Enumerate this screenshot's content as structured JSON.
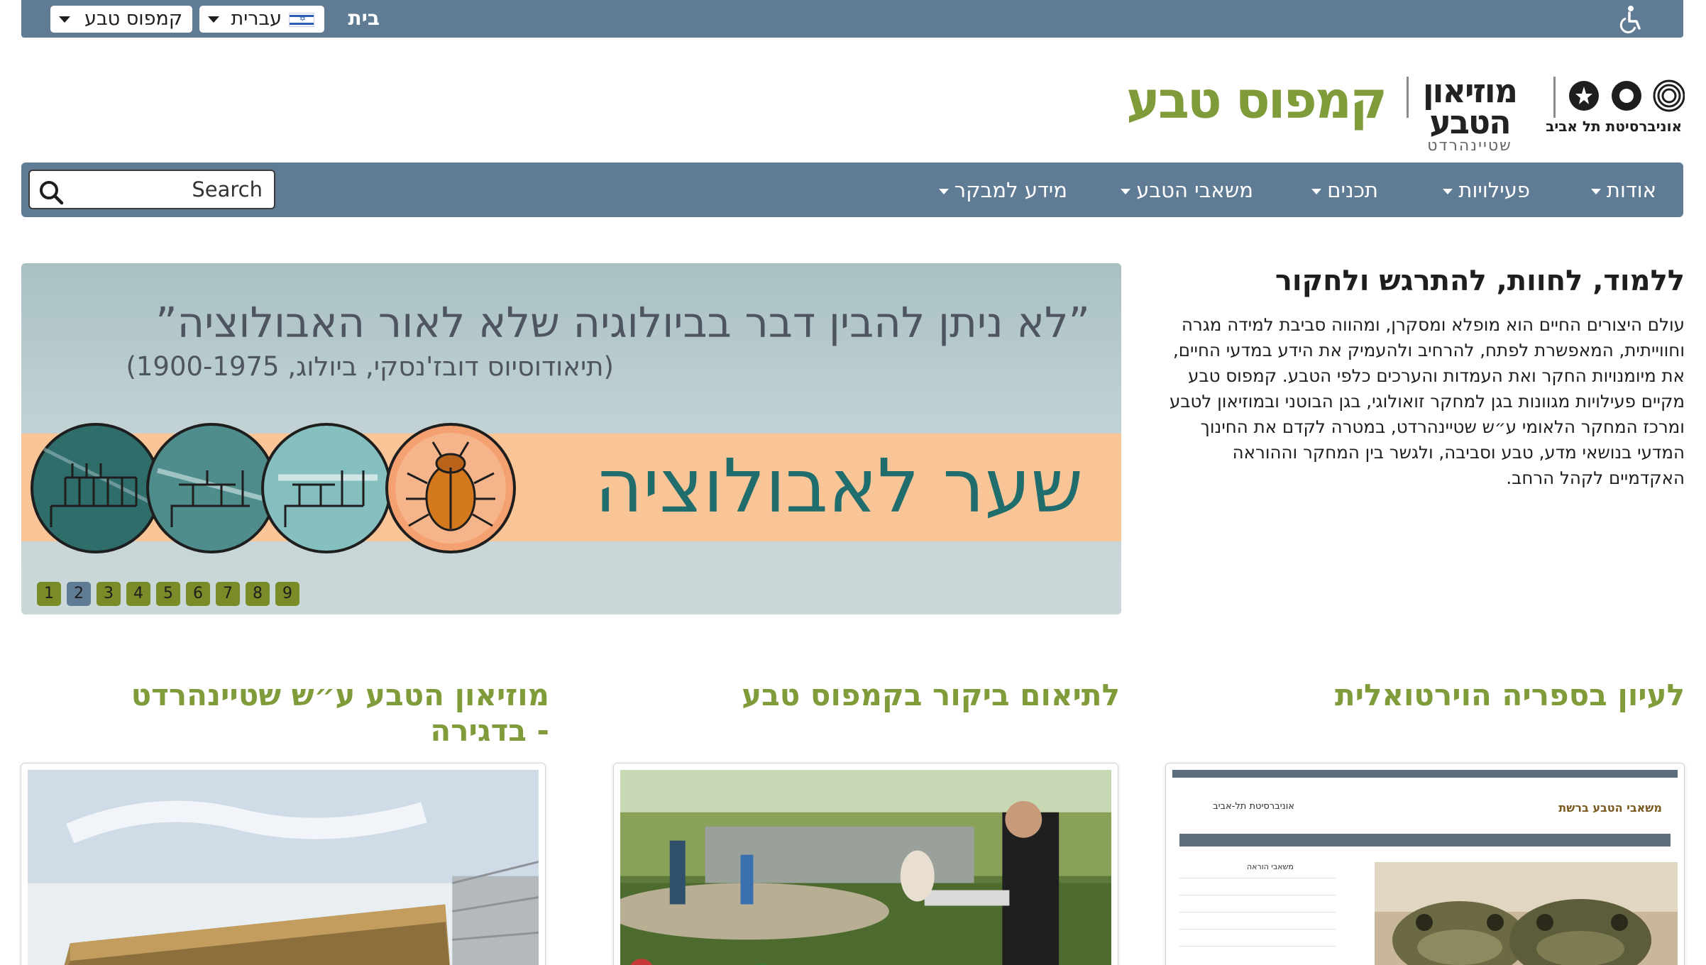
{
  "topbar": {
    "home_label": "בית",
    "language_label": "עברית",
    "site_selector_label": "קמפוס טבע",
    "accessibility_icon": "wheelchair-icon",
    "bar_color": "#607c95"
  },
  "logos": {
    "tau_text": "אוניברסיטת תל אביב",
    "museum_line1": "מוזיאון",
    "museum_line2": "הטבע",
    "museum_line3": "שטיינהרדט",
    "campus_name": "קמפוס טבע",
    "campus_color": "#7f9b3a"
  },
  "nav": {
    "items": [
      {
        "label": "אודות"
      },
      {
        "label": "פעילויות"
      },
      {
        "label": "תכנים"
      },
      {
        "label": "משאבי הטבע"
      },
      {
        "label": "מידע למבקר"
      }
    ],
    "search_placeholder": "Search",
    "search_icon": "search-icon"
  },
  "intro": {
    "title": "ללמוד, לחוות, להתרגש ולחקור",
    "body": "עולם היצורים החיים הוא מופלא ומסקרן, ומהווה סביבת למידה מגרה וחווייתית, המאפשרת לפתח, להרחיב ולהעמיק את הידע במדעי החיים, את מיומנויות החקר ואת העמדות והערכים כלפי הטבע. קמפוס טבע מקיים פעילויות מגוונות בגן למחקר זואולוגי, בגן הבוטני ובמוזיאון לטבע ומרכז המחקר הלאומי ע״ש שטיינהרדט, במטרה לקדם את החינוך המדעי בנושאי מדע, טבע וסביבה, ולגשר בין המחקר וההוראה האקדמיים לקהל הרחב."
  },
  "banner": {
    "quote": "”לא ניתן להבין דבר בביולוגיה שלא לאור האבולוציה”",
    "quote_source": "(תיאודוסיוס דובז'נסקי, ביולוג, 1900-1975)",
    "title": "שער לאבולוציה",
    "beetle_icon": "beetle-icon",
    "tree_icons": [
      "phylogeny-tree-icon",
      "phylogeny-tree-icon",
      "phylogeny-tree-icon"
    ],
    "slides": [
      "1",
      "2",
      "3",
      "4",
      "5",
      "6",
      "7",
      "8",
      "9"
    ],
    "active_slide": "2"
  },
  "columns": [
    {
      "heading": "לעיון בספריה הוירטואלית"
    },
    {
      "heading": "לתיאום ביקור בקמפוס טבע"
    },
    {
      "heading": "מוזיאון הטבע ע״ש שטיינהרדט - בדגירה"
    }
  ],
  "mini_screenshot": {
    "title": "משאבי הטבע ברשת",
    "logo_text": "אוניברסיטת תל-אביב",
    "side_heading": "משאבי הוראה"
  }
}
